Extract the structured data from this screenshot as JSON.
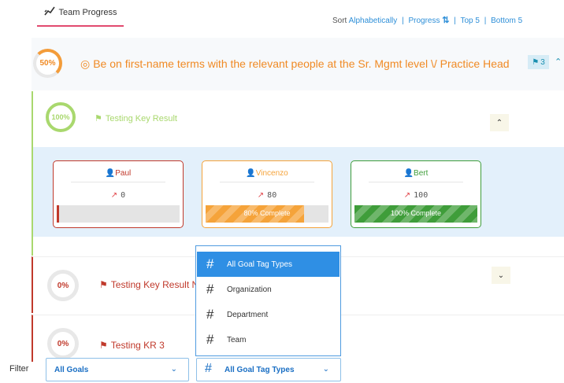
{
  "header": {
    "tab_label": "Team Progress",
    "sort_prefix": "Sort",
    "sort_options": [
      "Alphabetically",
      "Progress",
      "Top 5",
      "Bottom 5"
    ]
  },
  "objective": {
    "percent": "50%",
    "progress": 0.5,
    "title": "Be on first-name terms with the relevant people at the Sr. Mgmt level \\/ Practice Head",
    "badge_count": "3"
  },
  "key_results": [
    {
      "percent": "100%",
      "progress": 1.0,
      "title": "Testing Key Result",
      "owners": [
        {
          "name": "Paul",
          "value": "0",
          "bar_label": "",
          "progress": 0.02,
          "color": "#c0392b"
        },
        {
          "name": "Vincenzo",
          "value": "80",
          "bar_label": "80% Complete",
          "progress": 0.8,
          "color": "#f5a33a"
        },
        {
          "name": "Bert",
          "value": "100",
          "bar_label": "100% Complete",
          "progress": 1.0,
          "color": "#3f9d3a"
        }
      ]
    },
    {
      "percent": "0%",
      "progress": 0,
      "title": "Testing Key Result N"
    },
    {
      "percent": "0%",
      "progress": 0,
      "title": "Testing KR 3"
    }
  ],
  "tag_menu": {
    "items": [
      "All Goal Tag Types",
      "Organization",
      "Department",
      "Team"
    ],
    "selected_index": 0
  },
  "filter": {
    "label": "Filter",
    "goals_value": "All Goals",
    "tags_value": "All Goal Tag Types"
  },
  "colors": {
    "accent_blue": "#2f8fe4",
    "objective_orange": "#f08a24",
    "kr_green": "#a9d86e",
    "kr_red": "#c0392b",
    "tab_underline": "#e24a6f"
  },
  "icons": {
    "tab": "progress-chart-icon",
    "objective": "target-icon",
    "kr_flag": "flag-icon",
    "owner": "user-icon",
    "trend": "trend-up-icon",
    "tag": "hash-icon",
    "chevron": "chevron-down-icon"
  }
}
